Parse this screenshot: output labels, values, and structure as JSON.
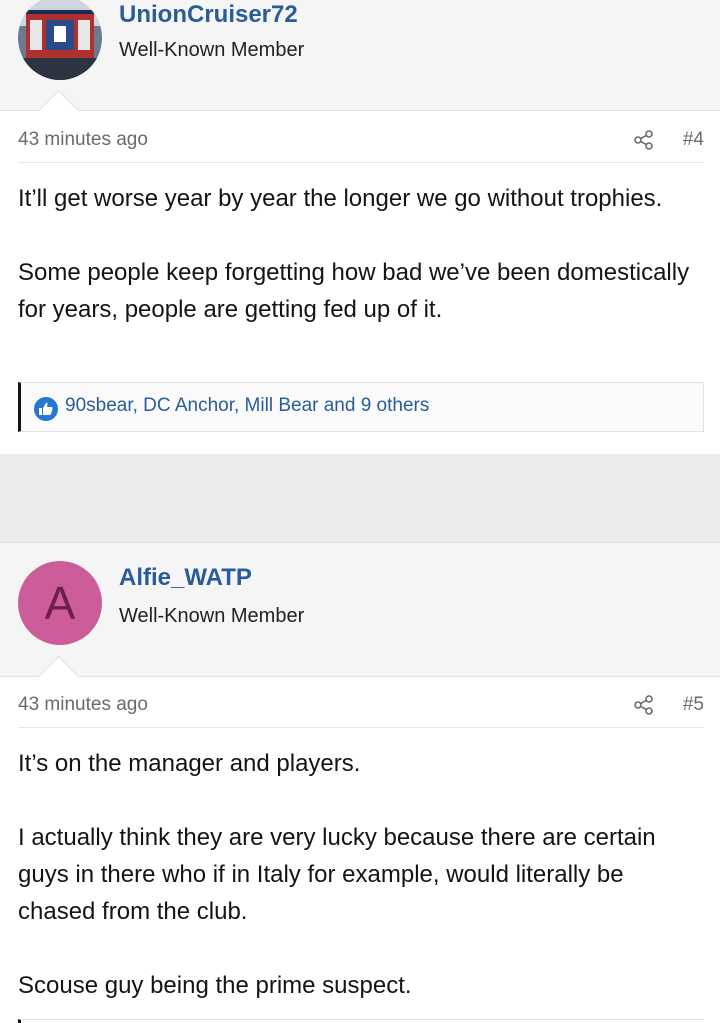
{
  "posts": [
    {
      "username": "UnionCruiser72",
      "user_title": "Well-Known Member",
      "time": "43 minutes ago",
      "number": "#4",
      "paragraphs": [
        "It’ll get worse year by year the longer we go without trophies.",
        "Some people keep forgetting how bad we’ve been domestically for years, people are getting fed up of it."
      ],
      "reactions": "90sbear, DC Anchor, Mill Bear and 9 others"
    },
    {
      "username": "Alfie_WATP",
      "avatar_letter": "A",
      "user_title": "Well-Known Member",
      "time": "43 minutes ago",
      "number": "#5",
      "paragraphs": [
        "It’s on the manager and players.",
        "I actually think they are very lucky because there are certain guys in there who if in Italy for example, would literally be chased from the club.",
        "Scouse guy being the prime suspect."
      ]
    }
  ],
  "icons": {
    "share": "share-icon",
    "like": "like-icon"
  },
  "colors": {
    "username": "#2a5c9a",
    "avatar_a": "#cc5c9a",
    "like": "#2577d1"
  }
}
